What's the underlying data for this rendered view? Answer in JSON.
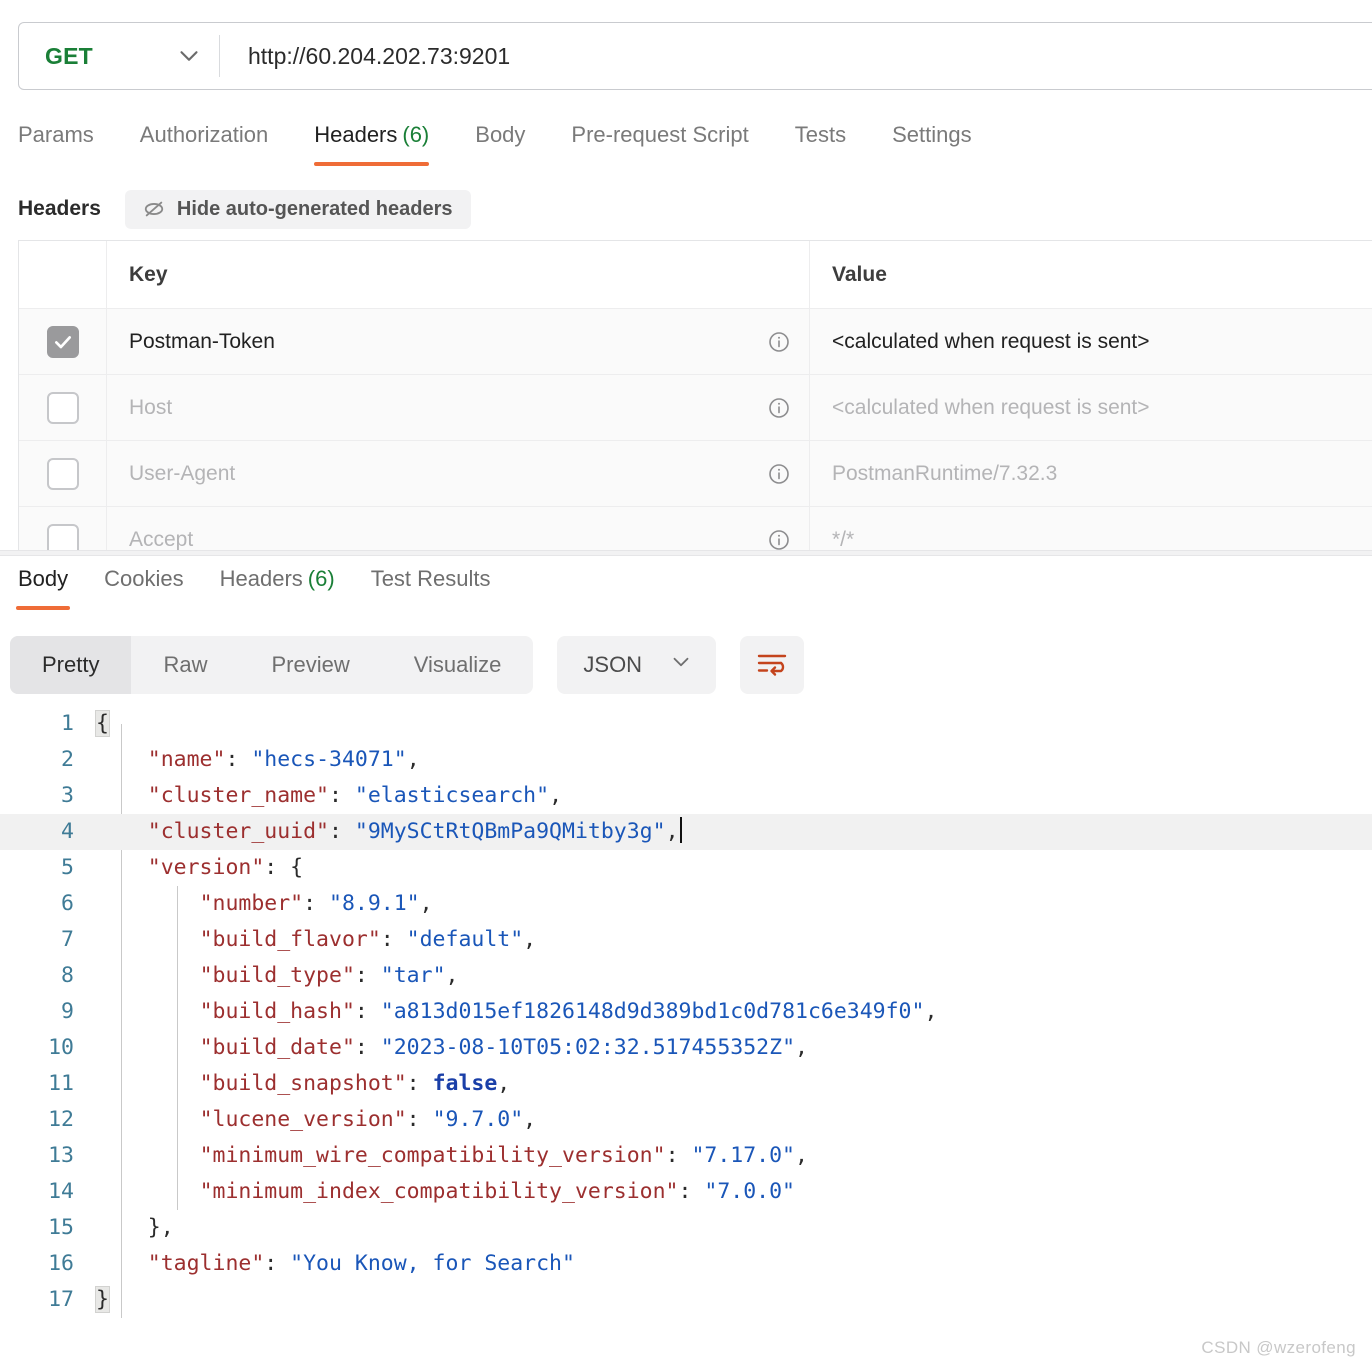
{
  "request_bar": {
    "method": "GET",
    "method_caret_icon": "chevron-down-icon",
    "url": "http://60.204.202.73:9201"
  },
  "request_tabs": [
    {
      "label": "Params",
      "count": "",
      "active": false
    },
    {
      "label": "Authorization",
      "count": "",
      "active": false
    },
    {
      "label": "Headers",
      "count": "(6)",
      "active": true
    },
    {
      "label": "Body",
      "count": "",
      "active": false
    },
    {
      "label": "Pre-request Script",
      "count": "",
      "active": false
    },
    {
      "label": "Tests",
      "count": "",
      "active": false
    },
    {
      "label": "Settings",
      "count": "",
      "active": false
    }
  ],
  "headers_toolbar": {
    "title": "Headers",
    "hide_auto_label": "Hide auto-generated headers",
    "hide_auto_icon": "eye-off-icon"
  },
  "headers_table": {
    "columns": {
      "key": "Key",
      "value": "Value"
    },
    "rows": [
      {
        "checked": true,
        "key": "Postman-Token",
        "value": "<calculated when request is sent>",
        "muted": false,
        "info_icon": "info-circle-icon"
      },
      {
        "checked": false,
        "key": "Host",
        "value": "<calculated when request is sent>",
        "muted": true,
        "info_icon": "info-circle-icon"
      },
      {
        "checked": false,
        "key": "User-Agent",
        "value": "PostmanRuntime/7.32.3",
        "muted": true,
        "info_icon": "info-circle-icon"
      },
      {
        "checked": false,
        "key": "Accept",
        "value": "*/*",
        "muted": true,
        "info_icon": "info-circle-icon"
      }
    ]
  },
  "response_tabs": [
    {
      "label": "Body",
      "count": "",
      "active": true
    },
    {
      "label": "Cookies",
      "count": "",
      "active": false
    },
    {
      "label": "Headers",
      "count": "(6)",
      "active": false
    },
    {
      "label": "Test Results",
      "count": "",
      "active": false
    }
  ],
  "body_toolbar": {
    "views": [
      {
        "label": "Pretty",
        "active": true
      },
      {
        "label": "Raw",
        "active": false
      },
      {
        "label": "Preview",
        "active": false
      },
      {
        "label": "Visualize",
        "active": false
      }
    ],
    "format": "JSON",
    "format_caret_icon": "chevron-down-icon",
    "wrap_button_icon": "wrap-text-icon"
  },
  "response_body": {
    "language": "json",
    "raw": "{\n    \"name\": \"hecs-34071\",\n    \"cluster_name\": \"elasticsearch\",\n    \"cluster_uuid\": \"9MySCtRtQBmPa9QMitby3g\",\n    \"version\": {\n        \"number\": \"8.9.1\",\n        \"build_flavor\": \"default\",\n        \"build_type\": \"tar\",\n        \"build_hash\": \"a813d015ef1826148d9d389bd1c0d781c6e349f0\",\n        \"build_date\": \"2023-08-10T05:02:32.517455352Z\",\n        \"build_snapshot\": false,\n        \"lucene_version\": \"9.7.0\",\n        \"minimum_wire_compatibility_version\": \"7.17.0\",\n        \"minimum_index_compatibility_version\": \"7.0.0\"\n    },\n    \"tagline\": \"You Know, for Search\"\n}",
    "highlighted_line": 4,
    "cursor_line": 4,
    "lines": [
      {
        "n": "1",
        "indent": 0,
        "tokens": [
          {
            "t": "{",
            "c": "brace-hl p"
          }
        ]
      },
      {
        "n": "2",
        "indent": 1,
        "tokens": [
          {
            "t": "\"name\"",
            "c": "k"
          },
          {
            "t": ": ",
            "c": "p"
          },
          {
            "t": "\"hecs-34071\"",
            "c": "s"
          },
          {
            "t": ",",
            "c": "p"
          }
        ]
      },
      {
        "n": "3",
        "indent": 1,
        "tokens": [
          {
            "t": "\"cluster_name\"",
            "c": "k"
          },
          {
            "t": ": ",
            "c": "p"
          },
          {
            "t": "\"elasticsearch\"",
            "c": "s"
          },
          {
            "t": ",",
            "c": "p"
          }
        ]
      },
      {
        "n": "4",
        "indent": 1,
        "tokens": [
          {
            "t": "\"cluster_uuid\"",
            "c": "k"
          },
          {
            "t": ": ",
            "c": "p"
          },
          {
            "t": "\"9MySCtRtQBmPa9QMitby3g\"",
            "c": "s"
          },
          {
            "t": ",",
            "c": "p"
          }
        ]
      },
      {
        "n": "5",
        "indent": 1,
        "tokens": [
          {
            "t": "\"version\"",
            "c": "k"
          },
          {
            "t": ": ",
            "c": "p"
          },
          {
            "t": "{",
            "c": "p"
          }
        ]
      },
      {
        "n": "6",
        "indent": 2,
        "tokens": [
          {
            "t": "\"number\"",
            "c": "k"
          },
          {
            "t": ": ",
            "c": "p"
          },
          {
            "t": "\"8.9.1\"",
            "c": "s"
          },
          {
            "t": ",",
            "c": "p"
          }
        ]
      },
      {
        "n": "7",
        "indent": 2,
        "tokens": [
          {
            "t": "\"build_flavor\"",
            "c": "k"
          },
          {
            "t": ": ",
            "c": "p"
          },
          {
            "t": "\"default\"",
            "c": "s"
          },
          {
            "t": ",",
            "c": "p"
          }
        ]
      },
      {
        "n": "8",
        "indent": 2,
        "tokens": [
          {
            "t": "\"build_type\"",
            "c": "k"
          },
          {
            "t": ": ",
            "c": "p"
          },
          {
            "t": "\"tar\"",
            "c": "s"
          },
          {
            "t": ",",
            "c": "p"
          }
        ]
      },
      {
        "n": "9",
        "indent": 2,
        "tokens": [
          {
            "t": "\"build_hash\"",
            "c": "k"
          },
          {
            "t": ": ",
            "c": "p"
          },
          {
            "t": "\"a813d015ef1826148d9d389bd1c0d781c6e349f0\"",
            "c": "s"
          },
          {
            "t": ",",
            "c": "p"
          }
        ]
      },
      {
        "n": "10",
        "indent": 2,
        "tokens": [
          {
            "t": "\"build_date\"",
            "c": "k"
          },
          {
            "t": ": ",
            "c": "p"
          },
          {
            "t": "\"2023-08-10T05:02:32.517455352Z\"",
            "c": "s"
          },
          {
            "t": ",",
            "c": "p"
          }
        ]
      },
      {
        "n": "11",
        "indent": 2,
        "tokens": [
          {
            "t": "\"build_snapshot\"",
            "c": "k"
          },
          {
            "t": ": ",
            "c": "p"
          },
          {
            "t": "false",
            "c": "b"
          },
          {
            "t": ",",
            "c": "p"
          }
        ]
      },
      {
        "n": "12",
        "indent": 2,
        "tokens": [
          {
            "t": "\"lucene_version\"",
            "c": "k"
          },
          {
            "t": ": ",
            "c": "p"
          },
          {
            "t": "\"9.7.0\"",
            "c": "s"
          },
          {
            "t": ",",
            "c": "p"
          }
        ]
      },
      {
        "n": "13",
        "indent": 2,
        "tokens": [
          {
            "t": "\"minimum_wire_compatibility_version\"",
            "c": "k"
          },
          {
            "t": ": ",
            "c": "p"
          },
          {
            "t": "\"7.17.0\"",
            "c": "s"
          },
          {
            "t": ",",
            "c": "p"
          }
        ]
      },
      {
        "n": "14",
        "indent": 2,
        "tokens": [
          {
            "t": "\"minimum_index_compatibility_version\"",
            "c": "k"
          },
          {
            "t": ": ",
            "c": "p"
          },
          {
            "t": "\"7.0.0\"",
            "c": "s"
          }
        ]
      },
      {
        "n": "15",
        "indent": 1,
        "tokens": [
          {
            "t": "}",
            "c": "p"
          },
          {
            "t": ",",
            "c": "p"
          }
        ]
      },
      {
        "n": "16",
        "indent": 1,
        "tokens": [
          {
            "t": "\"tagline\"",
            "c": "k"
          },
          {
            "t": ": ",
            "c": "p"
          },
          {
            "t": "\"You Know, for Search\"",
            "c": "s"
          }
        ]
      },
      {
        "n": "17",
        "indent": 0,
        "tokens": [
          {
            "t": "}",
            "c": "brace-hl p"
          }
        ]
      }
    ]
  },
  "watermark": "CSDN @wzerofeng",
  "colors": {
    "accent_orange": "#ef6c37",
    "green": "#1a7f37",
    "json_key": "#9c2f2f",
    "json_string": "#1a56b8",
    "json_bool": "#1a3fa8",
    "line_number": "#3f7b96"
  }
}
